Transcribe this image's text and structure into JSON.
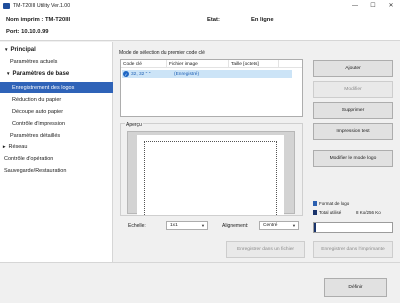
{
  "window": {
    "title": "TM-T20III Utility Ver.1.00",
    "minimize": "—",
    "maximize": "☐",
    "close": "✕"
  },
  "info": {
    "printer": "Nom imprim : TM-T20III",
    "port": "Port: 10.10.0.99",
    "status_label": "Etat:",
    "status_value": "En ligne"
  },
  "sidebar": {
    "items": [
      {
        "label": "Principal",
        "expander": "▼"
      },
      {
        "label": "Paramètres actuels"
      },
      {
        "label": "Paramètres de base",
        "expander": "▼"
      },
      {
        "label": "Enregistrement des logos"
      },
      {
        "label": "Réduction du papier"
      },
      {
        "label": "Découpe auto papier"
      },
      {
        "label": "Contrôle d'impression"
      },
      {
        "label": "Paramètres détaillés"
      },
      {
        "label": "Réseau",
        "expander": "►"
      },
      {
        "label": "Contrôle d'opération"
      },
      {
        "label": "Sauvegarde/Restauration"
      }
    ]
  },
  "logo_list": {
    "label": "Mode de sélection du premier code clé",
    "columns": [
      "Code clé",
      "Fichier image",
      "Taille [octets]"
    ],
    "rows": [
      {
        "check": "✓",
        "code": "32, 32  \" \"",
        "file": "(Enregistré)",
        "size": ""
      }
    ]
  },
  "preview": {
    "label": "Aperçu"
  },
  "options": {
    "scale_label": "Echelle:",
    "scale_value": "1x1",
    "align_label": "Alignement:",
    "align_value": "Centré",
    "arrow": "▼"
  },
  "buttons": {
    "add": "Ajouter",
    "modify": "Modifier",
    "delete": "Supprimer",
    "print_test": "Impression test",
    "change_logo_mode": "Modifier le mode logo",
    "save_file": "Enregistrer dans un fichier",
    "save_printer": "Enregistrer dans l'imprimante",
    "define": "Définir"
  },
  "capacity": {
    "format_label": "Format de logo",
    "total_label": "Total utilisé",
    "total_value": "8 Ko/256 Ko",
    "used_fraction": 0.03,
    "format_color": "#2b5fb0",
    "total_color": "#19336b"
  }
}
